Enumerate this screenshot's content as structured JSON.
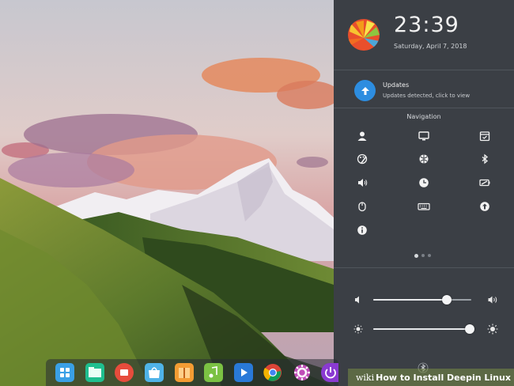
{
  "panel": {
    "time": "23:39",
    "date": "Saturday, April 7, 2018",
    "updates": {
      "title": "Updates",
      "description": "Updates detected, click to view"
    },
    "navigation_title": "Navigation",
    "nav_items": [
      "account-icon",
      "display-icon",
      "calendar-icon",
      "personalization-icon",
      "network-icon",
      "bluetooth-icon",
      "sound-icon",
      "time-icon",
      "power-icon",
      "mouse-icon",
      "keyboard-icon",
      "update-icon",
      "info-icon"
    ],
    "volume_level": 0.75,
    "brightness_level": 0.98
  },
  "dock": {
    "items": [
      "launcher-icon",
      "file-manager-icon",
      "screen-recorder-icon",
      "app-store-icon",
      "archive-icon",
      "music-icon",
      "video-icon",
      "chrome-icon",
      "settings-icon",
      "power-icon"
    ]
  },
  "watermark": {
    "wiki": "wiki",
    "text": "How to Install Deepin Linux"
  },
  "colors": {
    "accent": "#2d8de0",
    "panel_bg": "#3b3f45"
  }
}
